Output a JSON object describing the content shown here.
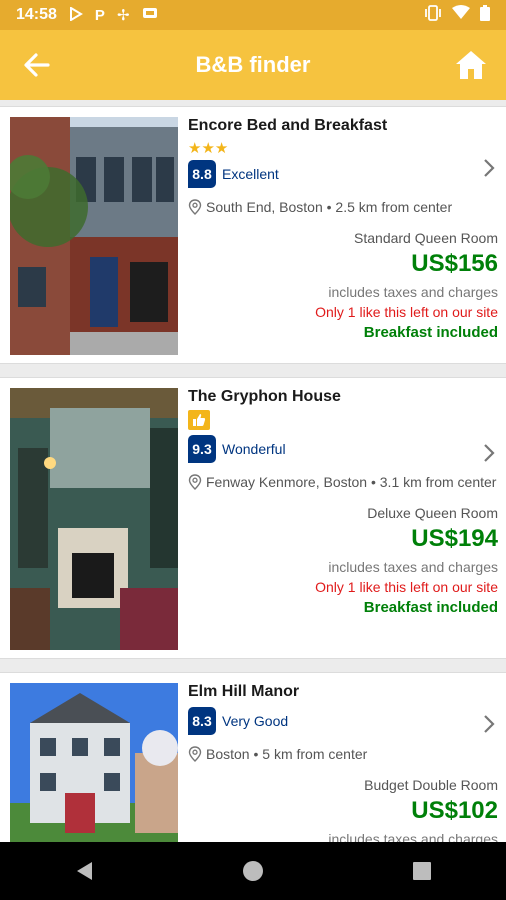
{
  "status_bar": {
    "time": "14:58",
    "left_icons": [
      "play-store-icon",
      "parking-icon",
      "pinwheel-icon",
      "sim-icon"
    ],
    "right_icons": [
      "vibrate-icon",
      "wifi-icon",
      "battery-icon"
    ]
  },
  "toolbar": {
    "title": "B&B finder",
    "back_icon": "arrow-left-icon",
    "home_icon": "home-icon"
  },
  "colors": {
    "status_bar": "#e6ab2e",
    "toolbar": "#f6c33f",
    "price_green": "#008009",
    "score_blue": "#003580",
    "alert_red": "#e01b1b",
    "star_yellow": "#f3b51a"
  },
  "hotels": [
    {
      "name": "Encore Bed and Breakfast",
      "stars": "★★★",
      "score": "8.8",
      "rating_word": "Excellent",
      "location": "South End, Boston • 2.5 km from center",
      "room": "Standard Queen Room",
      "price": "US$156",
      "taxes": "includes taxes and charges",
      "availability": "Only 1 like this left on our site",
      "meal": "Breakfast included"
    },
    {
      "name": "The Gryphon House",
      "badge_icon": "thumbs-up-icon",
      "score": "9.3",
      "rating_word": "Wonderful",
      "location": "Fenway Kenmore, Boston • 3.1 km from center",
      "room": "Deluxe Queen Room",
      "price": "US$194",
      "taxes": "includes taxes and charges",
      "availability": "Only 1 like this left on our site",
      "meal": "Breakfast included"
    },
    {
      "name": "Elm Hill Manor",
      "score": "8.3",
      "rating_word": "Very Good",
      "location": "Boston • 5 km from center",
      "room": "Budget Double Room",
      "price": "US$102",
      "taxes": "includes taxes and charges"
    }
  ],
  "nav_bar": [
    "back-triangle-icon",
    "home-circle-icon",
    "recents-square-icon"
  ]
}
